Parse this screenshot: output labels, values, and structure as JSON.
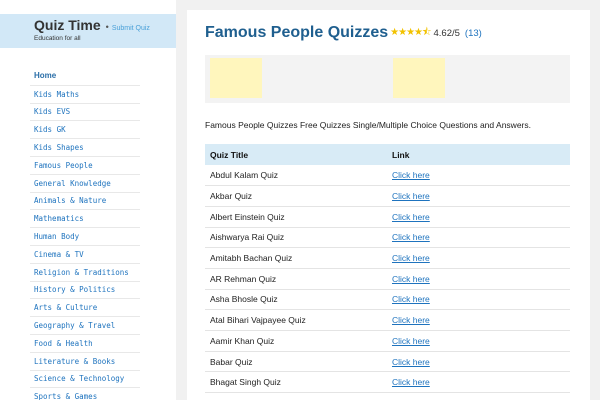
{
  "sidebar": {
    "site_title": "Quiz Time",
    "separator": "•",
    "submit_label": "Submit Quiz",
    "tagline": "Education for all",
    "nav_items": [
      "Home",
      "Kids Maths",
      "Kids EVS",
      "Kids GK",
      "Kids Shapes",
      "Famous People",
      "General Knowledge",
      "Animals & Nature",
      "Mathematics",
      "Human Body",
      "Cinema & TV",
      "Religion & Traditions",
      "History & Politics",
      "Arts & Culture",
      "Geography & Travel",
      "Food & Health",
      "Literature & Books",
      "Science & Technology",
      "Sports & Games"
    ]
  },
  "main": {
    "title": "Famous People Quizzes",
    "stars": "★★★★⯪",
    "rating": "4.62/5",
    "votes": "(13)",
    "intro": "Famous People Quizzes Free Quizzes Single/Multiple Choice Questions and Answers.",
    "table": {
      "headers": [
        "Quiz Title",
        "Link"
      ],
      "rows": [
        {
          "title": "Abdul Kalam Quiz",
          "link": "Click here"
        },
        {
          "title": "Akbar Quiz",
          "link": "Click here"
        },
        {
          "title": "Albert Einstein Quiz",
          "link": "Click here"
        },
        {
          "title": "Aishwarya Rai Quiz",
          "link": "Click here"
        },
        {
          "title": "Amitabh Bachan Quiz",
          "link": "Click here"
        },
        {
          "title": "AR Rehman Quiz",
          "link": "Click here"
        },
        {
          "title": "Asha Bhosle Quiz",
          "link": "Click here"
        },
        {
          "title": "Atal Bihari Vajpayee Quiz",
          "link": "Click here"
        },
        {
          "title": "Aamir Khan Quiz",
          "link": "Click here"
        },
        {
          "title": "Babar Quiz",
          "link": "Click here"
        },
        {
          "title": "Bhagat Singh Quiz",
          "link": "Click here"
        }
      ]
    }
  },
  "colors": {
    "brand_bg": "#d2e8f7",
    "title": "#1f5f8f",
    "link": "#1e73be",
    "star": "#f2c200",
    "table_header": "#d8ebf6",
    "ad_placeholder": "#fff6bd"
  }
}
